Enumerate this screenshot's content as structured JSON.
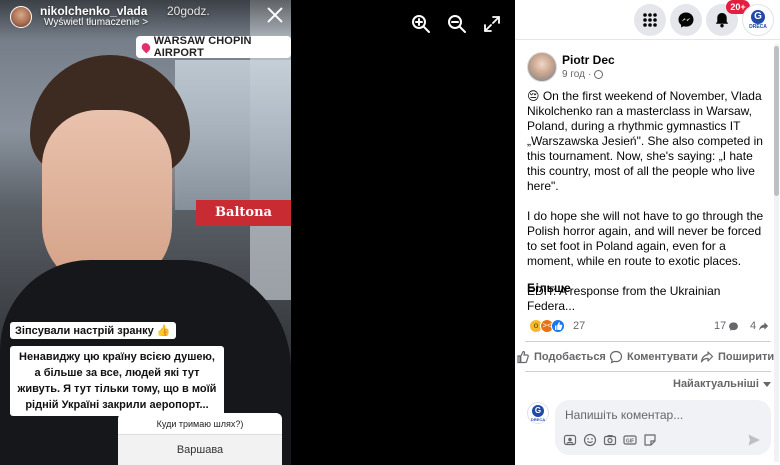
{
  "story": {
    "username": "nikolchenko_vlada",
    "time": "20godz.",
    "translate_label": "Wyświetl tłumaczenie >",
    "location": "WARSAW CHOPIN AIRPORT",
    "sign_text": "Baltona",
    "sticker_mood": "Зіпсували настрій зранку 👍",
    "sticker_text": "Ненавиджу цю країну всією душею, а більше за все, людей які тут живуть. Я тут тільки тому, що в моїй рідній Україні закрили аеропорт...",
    "question": "Куди тримаю шлях?)",
    "answer": "Варшава"
  },
  "topbar": {
    "notifications_badge": "20+",
    "logo_text": "DRECA"
  },
  "post": {
    "author": "Piotr Dec",
    "time": "9 год",
    "paragraph1": "😔 On the first weekend of November, Vlada Nikolchenko ran a masterclass in Warsaw, Poland, during a rhythmic gymnastics IT „Warszawska Jesień\". She also competed in this tournament. Now, she's saying: „I hate this country, most of all the people who live here\".",
    "paragraph2": "I do hope she will not have to go through the Polish horror again, and will never be forced to set foot in Poland again, even for a moment, while en route to exotic places.",
    "paragraph3": "EDIT: A response from the Ukrainian Federa...",
    "see_more": "Більше",
    "reaction_count": "27",
    "comment_count": "17",
    "share_count": "4"
  },
  "actions": {
    "like": "Подобається",
    "comment": "Коментувати",
    "share": "Поширити"
  },
  "comments": {
    "sort_label": "Найактуальніші",
    "placeholder": "Напишіть коментар..."
  },
  "colors": {
    "fb_blue": "#1877f2",
    "badge_red": "#e41e3f",
    "text_secondary": "#65676b"
  }
}
